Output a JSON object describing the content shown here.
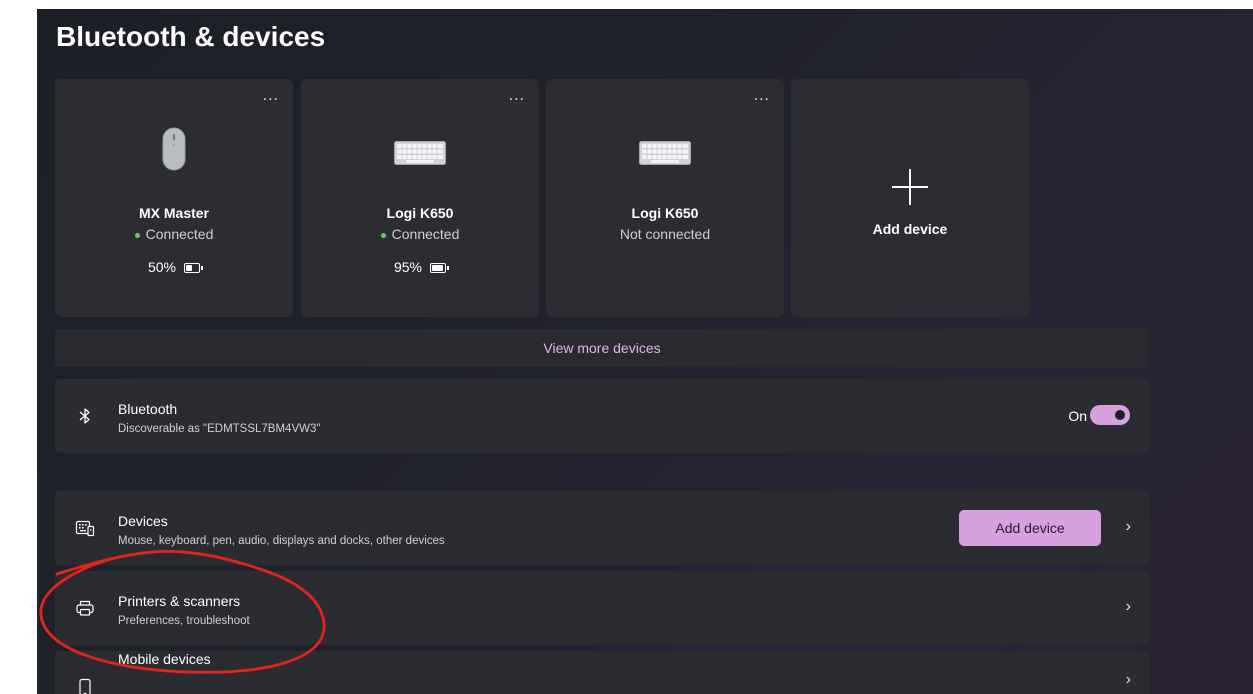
{
  "page": {
    "title": "Bluetooth & devices"
  },
  "cards": [
    {
      "name": "MX Master",
      "status": "Connected",
      "battery": "50%",
      "battery_level": 0.5,
      "more": "..."
    },
    {
      "name": "Logi K650",
      "status": "Connected",
      "battery": "95%",
      "battery_level": 0.95,
      "more": "..."
    },
    {
      "name": "Logi K650",
      "status": "Not connected",
      "more": "..."
    }
  ],
  "add_card": {
    "label": "Add device"
  },
  "view_more": {
    "label": "View more devices"
  },
  "bluetooth": {
    "title": "Bluetooth",
    "subtitle": "Discoverable as \"EDMTSSL7BM4VW3\"",
    "toggle_label": "On",
    "toggle_on": true
  },
  "devices_row": {
    "title": "Devices",
    "subtitle": "Mouse, keyboard, pen, audio, displays and docks, other devices",
    "button_label": "Add device"
  },
  "printers_row": {
    "title": "Printers & scanners",
    "subtitle": "Preferences, troubleshoot"
  },
  "mobile_row": {
    "title": "Mobile devices",
    "subtitle": ""
  },
  "colors": {
    "accent": "#d7a0df",
    "connected_dot": "#6ccb5f",
    "annotation": "#e0251b",
    "link": "#e0b7e6"
  }
}
